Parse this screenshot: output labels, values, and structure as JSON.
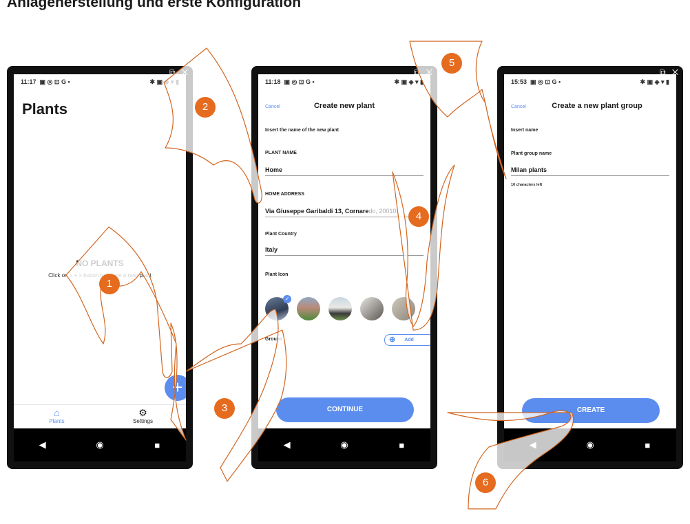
{
  "doc_title": "Anlagenerstellung und erste Konfiguration",
  "phone1": {
    "status_time": "11:17",
    "status_icons": "▣ ◎ ⊡ G •",
    "status_right": "✱ ▣ ◈ ▾ ▮",
    "title": "Plants",
    "empty_title": "NO PLANTS",
    "empty_sub": "Click on « + » button to create a new plant",
    "fab": "+",
    "tabs": [
      "Plants",
      "Settings"
    ]
  },
  "phone2": {
    "status_time": "11:18",
    "status_icons": "▣ ◎ ⊡ G •",
    "status_right": "✱ ▣ ◈ ▾ ▮",
    "cancel": "Cancel",
    "title": "Create new plant",
    "intro": "Insert the name of the new plant",
    "plant_name_label": "PLANT NAME",
    "plant_name": "Home",
    "address_label": "HOME ADDRESS",
    "address_value": "Via Giuseppe Garibaldi 13, Cornare",
    "address_faded": "do, 20010",
    "country_label": "Plant Country",
    "country": "Italy",
    "icon_label": "Plant Icon",
    "groups_label": "Groups",
    "add": "Add",
    "continue": "CONTINUE"
  },
  "phone3": {
    "status_time": "15:53",
    "status_icons": "▣ ◎ ⊡ G •",
    "status_right": "✱ ▣ ◈ ▾ ▮",
    "cancel": "Cancel",
    "title": "Create a new plant group",
    "insert_name": "Insert name",
    "group_label": "Plant group name",
    "group_value": "Milan plants",
    "chars_left": "10 characters left",
    "create": "CREATE"
  },
  "ext_icons": "⧉ ✕",
  "nav_glyphs": [
    "◀",
    "◉",
    "■"
  ],
  "badges": [
    "1",
    "2",
    "3",
    "4",
    "5",
    "6"
  ],
  "colors": {
    "accent": "#5b8def",
    "badge": "#e56b1f",
    "hand_line": "#d2651f"
  }
}
